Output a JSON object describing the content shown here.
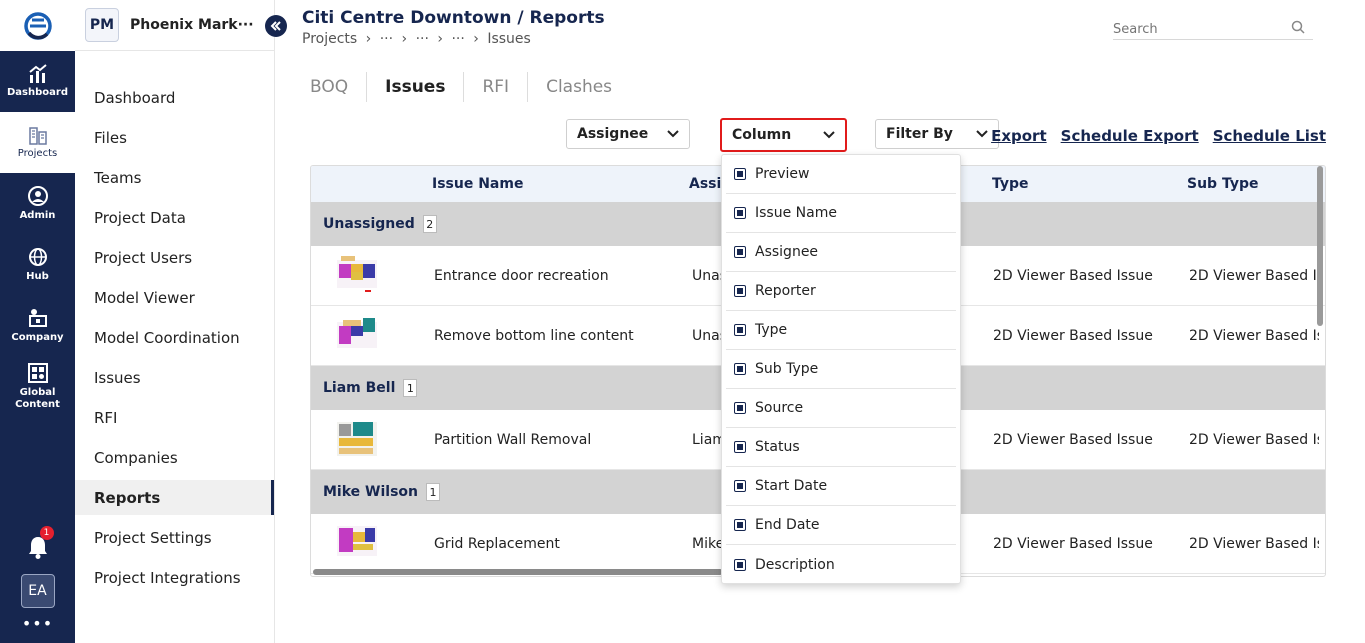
{
  "rail": {
    "items": [
      {
        "label": "Dashboard",
        "icon": "chart-icon"
      },
      {
        "label": "Projects",
        "icon": "building-icon"
      },
      {
        "label": "Admin",
        "icon": "admin-icon"
      },
      {
        "label": "Hub",
        "icon": "globe-icon"
      },
      {
        "label": "Company",
        "icon": "company-icon"
      },
      {
        "label": "Global Content",
        "icon": "grid-icon"
      }
    ],
    "notifications": "1",
    "avatar": "EA",
    "more": "•••"
  },
  "sidebar": {
    "project_badge": "PM",
    "project_name": "Phoenix Mark···",
    "items": [
      "Dashboard",
      "Files",
      "Teams",
      "Project Data",
      "Project Users",
      "Model Viewer",
      "Model Coordination",
      "Issues",
      "RFI",
      "Companies",
      "Reports",
      "Project Settings",
      "Project Integrations"
    ],
    "active": "Reports"
  },
  "header": {
    "title": "Citi Centre Downtown / Reports",
    "breadcrumb": [
      "Projects",
      "›",
      "···",
      "›",
      "···",
      "›",
      "···",
      "›",
      "Issues"
    ],
    "search_placeholder": "Search"
  },
  "tabs": [
    "BOQ",
    "Issues",
    "RFI",
    "Clashes"
  ],
  "toolbar": {
    "assignee": "Assignee",
    "column": "Column",
    "filter": "Filter By",
    "export": "Export",
    "schedule_export": "Schedule Export",
    "schedule_list": "Schedule List"
  },
  "table": {
    "headers": {
      "issue_name": "Issue Name",
      "assignee": "Assig",
      "type": "Type",
      "sub_type": "Sub Type"
    },
    "groups": [
      {
        "name": "Unassigned",
        "count": "2",
        "rows": [
          {
            "name": "Entrance door recreation",
            "assignee": "Unas",
            "type": "2D Viewer Based Issue",
            "sub_type": "2D Viewer Based Is"
          },
          {
            "name": "Remove bottom line content",
            "assignee": "Unas",
            "type": "2D Viewer Based Issue",
            "sub_type": "2D Viewer Based Is"
          }
        ]
      },
      {
        "name": "Liam Bell",
        "count": "1",
        "rows": [
          {
            "name": "Partition Wall Removal",
            "assignee": "Liam",
            "type": "2D Viewer Based Issue",
            "sub_type": "2D Viewer Based Is"
          }
        ]
      },
      {
        "name": "Mike Wilson",
        "count": "1",
        "rows": [
          {
            "name": "Grid Replacement",
            "assignee": "Mike",
            "type": "2D Viewer Based Issue",
            "sub_type": "2D Viewer Based Is"
          }
        ]
      }
    ]
  },
  "column_menu": [
    "Preview",
    "Issue Name",
    "Assignee",
    "Reporter",
    "Type",
    "Sub Type",
    "Source",
    "Status",
    "Start Date",
    "End Date",
    "Description"
  ],
  "colors": {
    "navy": "#16264f",
    "highlight_red": "#e11b1b",
    "group_gray": "#d3d3d3",
    "header_blue": "#eef3fa"
  }
}
